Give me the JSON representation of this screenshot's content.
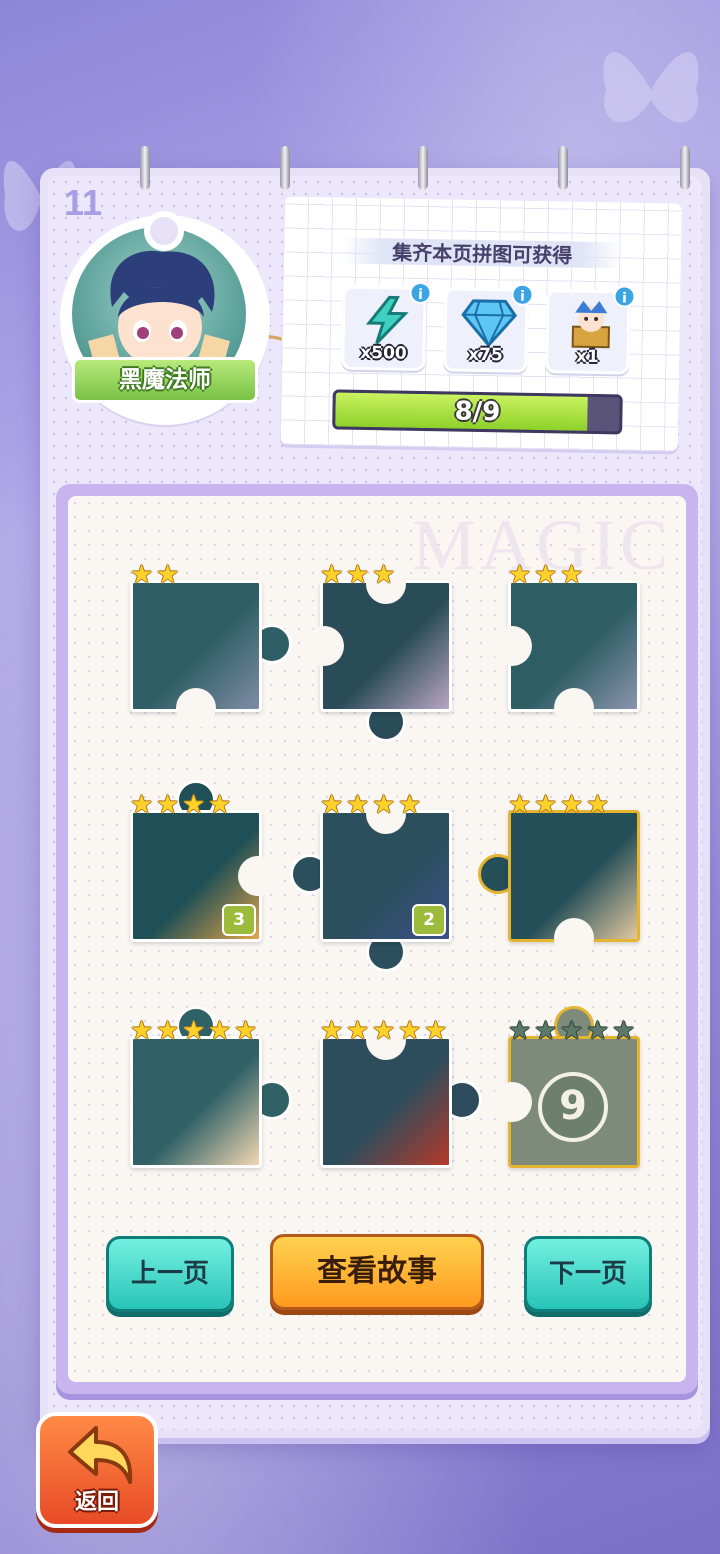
{
  "page": {
    "number": "11"
  },
  "character": {
    "name": "黑魔法师"
  },
  "reward_panel": {
    "title": "集齐本页拼图可获得",
    "rewards": [
      {
        "icon": "lightning-energy-icon",
        "qty": "x500",
        "info": "i"
      },
      {
        "icon": "diamond-gem-icon",
        "qty": "x75",
        "info": "i"
      },
      {
        "icon": "jester-character-icon",
        "qty": "x1",
        "info": "i"
      }
    ],
    "progress_text": "8/9",
    "progress_fraction": 0.889
  },
  "puzzle": {
    "watermark": "MAGIC",
    "pieces": [
      {
        "stars": 2,
        "max_stars": 2,
        "count": "",
        "locked": false
      },
      {
        "stars": 3,
        "max_stars": 3,
        "count": "",
        "locked": false
      },
      {
        "stars": 3,
        "max_stars": 3,
        "count": "",
        "locked": false
      },
      {
        "stars": 4,
        "max_stars": 4,
        "count": "3",
        "locked": false
      },
      {
        "stars": 4,
        "max_stars": 4,
        "count": "2",
        "locked": false
      },
      {
        "stars": 4,
        "max_stars": 4,
        "count": "",
        "locked": false
      },
      {
        "stars": 5,
        "max_stars": 5,
        "count": "",
        "locked": false
      },
      {
        "stars": 5,
        "max_stars": 5,
        "count": "",
        "locked": false
      },
      {
        "stars": 0,
        "max_stars": 5,
        "count": "",
        "locked": true,
        "locked_label": "9"
      }
    ]
  },
  "buttons": {
    "prev": "上一页",
    "story": "查看故事",
    "next": "下一页",
    "back": "返回"
  },
  "colors": {
    "star_on": "#ffd229",
    "star_off": "#5b7a6a",
    "teal_button": "#28c4b8",
    "orange_button": "#ff9a1f",
    "progress_fill": "#8ed12a"
  }
}
